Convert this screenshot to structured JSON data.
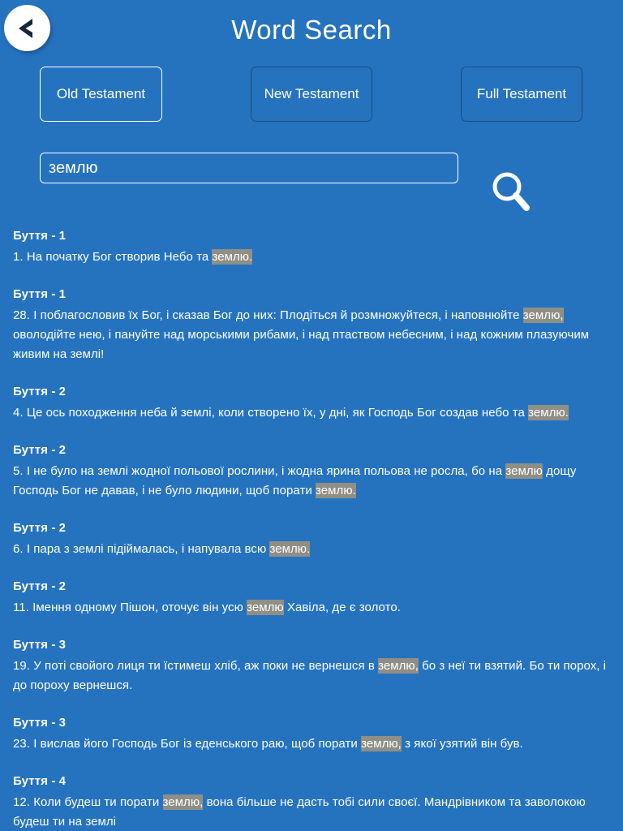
{
  "header": {
    "title": "Word Search",
    "back_icon": "chevron-left-icon"
  },
  "testaments": {
    "old": "Old Testament",
    "new": "New Testament",
    "full": "Full Testament",
    "selected": "Old Testament",
    "active_border_color": "#ffffff",
    "inactive_border_color": "#1b4a7d"
  },
  "search": {
    "value": "землю",
    "placeholder": "",
    "go_label": "Go",
    "go_icon": "magnifier-go-icon"
  },
  "theme": {
    "background": "#2573bf",
    "text": "#ffffff",
    "highlight_background": "#8f8f86"
  },
  "results": [
    {
      "ref": "Буття - 1",
      "parts": [
        {
          "t": "1. На початку Бог створив Небо та ",
          "h": false
        },
        {
          "t": "землю.",
          "h": true
        }
      ]
    },
    {
      "ref": "Буття - 1",
      "parts": [
        {
          "t": "28. І поблагословив їх Бог, і сказав Бог до них: Плодіться й розмножуйтеся, і наповнюйте ",
          "h": false
        },
        {
          "t": "землю,",
          "h": true
        },
        {
          "t": " оволодійте нею, і пануйте над морськими рибами, і над птаством небесним, і над кожним плазуючим живим на землі!",
          "h": false
        }
      ]
    },
    {
      "ref": "Буття - 2",
      "parts": [
        {
          "t": "4. Це ось походження неба й землі, коли створено їх, у дні, як Господь Бог создав небо та ",
          "h": false
        },
        {
          "t": "землю.",
          "h": true
        }
      ]
    },
    {
      "ref": "Буття - 2",
      "parts": [
        {
          "t": "5. І не було на землі жодної польової рослини, і жодна ярина польова не росла, бо на ",
          "h": false
        },
        {
          "t": "землю",
          "h": true
        },
        {
          "t": " дощу Господь Бог не давав, і не було людини, щоб порати ",
          "h": false
        },
        {
          "t": "землю.",
          "h": true
        }
      ]
    },
    {
      "ref": "Буття - 2",
      "parts": [
        {
          "t": "6. І пара з землі підіймалась, і напувала всю ",
          "h": false
        },
        {
          "t": "землю.",
          "h": true
        }
      ]
    },
    {
      "ref": "Буття - 2",
      "parts": [
        {
          "t": "11. Імення одному Пішон, оточує він усю ",
          "h": false
        },
        {
          "t": "землю",
          "h": true
        },
        {
          "t": " Хавіла, де є золото.",
          "h": false
        }
      ]
    },
    {
      "ref": "Буття - 3",
      "parts": [
        {
          "t": "19. У поті свойого лиця ти їстимеш хліб, аж поки не вернешся в ",
          "h": false
        },
        {
          "t": "землю,",
          "h": true
        },
        {
          "t": " бо з неї ти взятий. Бо ти порох, і до пороху вернешся.",
          "h": false
        }
      ]
    },
    {
      "ref": "Буття - 3",
      "parts": [
        {
          "t": "23. І вислав його Господь Бог із еденського раю, щоб порати ",
          "h": false
        },
        {
          "t": "землю,",
          "h": true
        },
        {
          "t": " з якої узятий він був.",
          "h": false
        }
      ]
    },
    {
      "ref": "Буття - 4",
      "parts": [
        {
          "t": "12. Коли будеш ти порати ",
          "h": false
        },
        {
          "t": "землю,",
          "h": true
        },
        {
          "t": " вона більше не дасть тобі сили своєї. Мандрівником та заволокою будеш ти на землі",
          "h": false
        }
      ]
    }
  ]
}
